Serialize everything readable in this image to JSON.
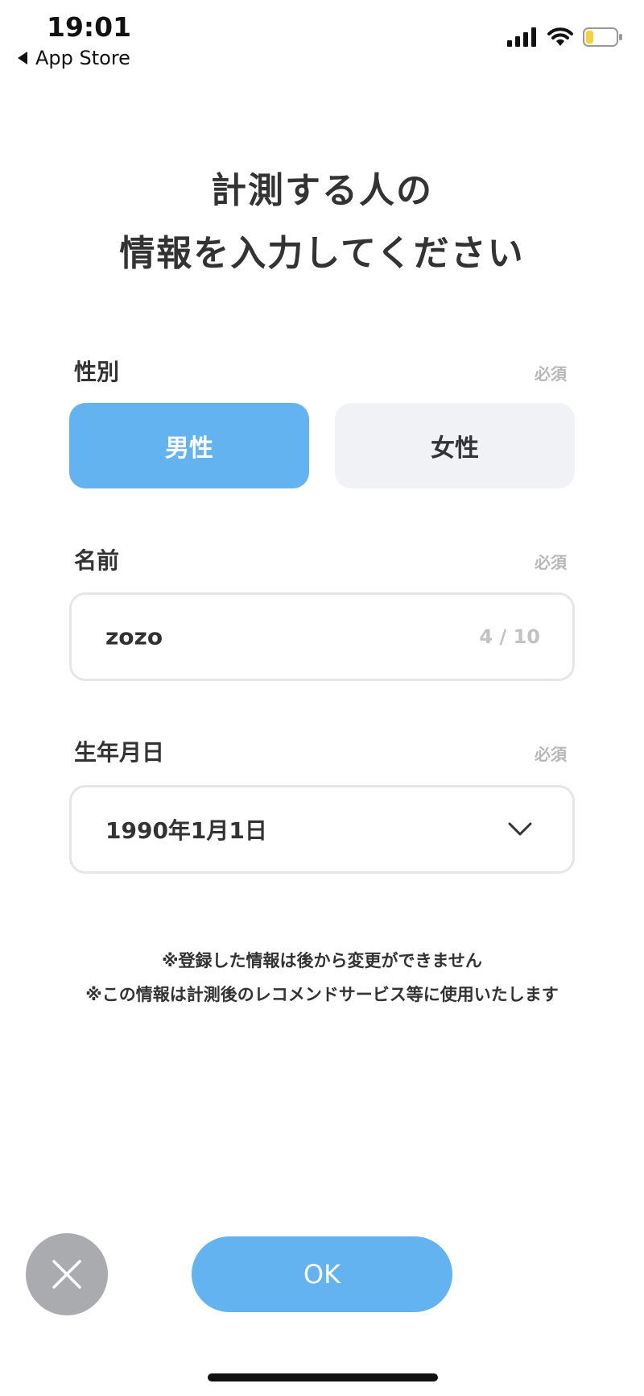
{
  "status_bar": {
    "time": "19:01",
    "back_label": "App Store"
  },
  "heading": {
    "line1": "計測する人の",
    "line2": "情報を入力してください"
  },
  "gender": {
    "label": "性別",
    "required": "必須",
    "options": [
      "男性",
      "女性"
    ],
    "selected": "男性"
  },
  "name": {
    "label": "名前",
    "required": "必須",
    "value": "zozo",
    "counter": "4 / 10"
  },
  "birthday": {
    "label": "生年月日",
    "required": "必須",
    "value": "1990年1月1日"
  },
  "notes": [
    "※登録した情報は後から変更ができません",
    "※この情報は計測後のレコメンドサービス等に使用いたします"
  ],
  "actions": {
    "ok_label": "OK"
  },
  "colors": {
    "accent": "#62b3ef",
    "inactive": "#f1f2f5",
    "close": "#a9abaf"
  }
}
